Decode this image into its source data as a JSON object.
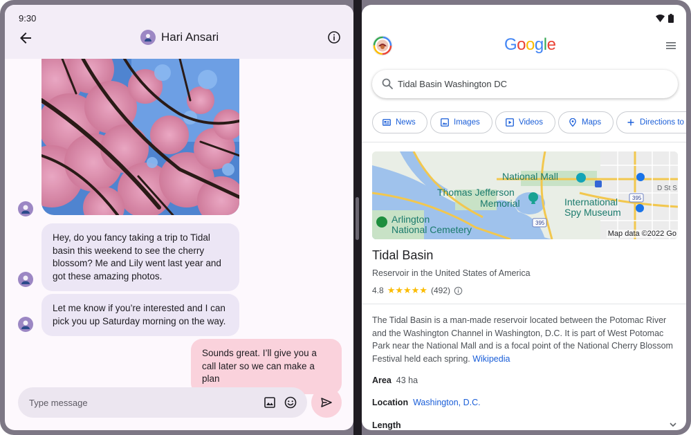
{
  "left": {
    "status_time": "9:30",
    "contact_name": "Hari Ansari",
    "messages": [
      {
        "direction": "in",
        "text": "Hey, do you fancy taking a trip to Tidal basin this weekend to see the cherry blossom? Me and Lily went last year and got these amazing photos."
      },
      {
        "direction": "in",
        "text": "Let me know if you’re interested and I can pick you up Saturday morning on the way."
      },
      {
        "direction": "out",
        "text": "Sounds great. I’ll give you a call later so we can make a plan"
      }
    ],
    "composer_placeholder": "Type message"
  },
  "right": {
    "logo_letters": [
      "G",
      "o",
      "o",
      "g",
      "l",
      "e"
    ],
    "logo_colors": [
      "#4285f4",
      "#ea4335",
      "#fbbc04",
      "#4285f4",
      "#34a853",
      "#ea4335"
    ],
    "search_value": "Tidal Basin Washington DC",
    "chips": [
      {
        "label": "News",
        "icon": "news-icon"
      },
      {
        "label": "Images",
        "icon": "image-icon"
      },
      {
        "label": "Videos",
        "icon": "video-icon"
      },
      {
        "label": "Maps",
        "icon": "map-pin-icon"
      },
      {
        "label": "Directions to",
        "icon": "plus-icon"
      }
    ],
    "map": {
      "labels": [
        "National Mall",
        "Thomas Jefferson",
        "Memorial",
        "International",
        "Spy Museum",
        "Arlington",
        "National Cemetery",
        "D St S"
      ],
      "highway_badges": [
        "395",
        "395"
      ],
      "credit": "Map data ©2022 Go"
    },
    "place_title": "Tidal Basin",
    "place_subtitle": "Reservoir in the United States of America",
    "rating": "4.8",
    "stars": "★★★★★",
    "review_count": "(492)",
    "description": "The Tidal Basin is a man-made reservoir located between the Potomac River and the Washington Channel in Washington, D.C. It is part of West Potomac Park near the National Mall and is a focal point of the National Cherry Blossom Festival held each spring.",
    "description_link": "Wikipedia",
    "facts": [
      {
        "key": "Area",
        "value": "43 ha"
      },
      {
        "key": "Location",
        "value": "Washington, D.C."
      },
      {
        "key": "Length",
        "value": ""
      }
    ]
  },
  "colors": {
    "accent_purple": "#9c87c4",
    "incoming_bubble": "#ece6f5",
    "outgoing_bubble": "#fad2dc",
    "link_blue": "#1a5ed8"
  }
}
